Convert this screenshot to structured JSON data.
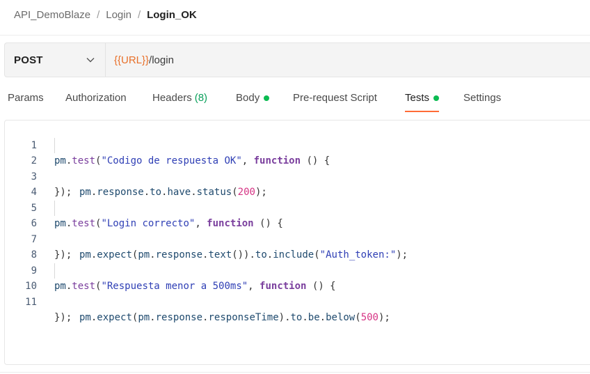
{
  "breadcrumb": {
    "collection": "API_DemoBlaze",
    "folder": "Login",
    "request": "Login_OK",
    "separator": "/"
  },
  "request": {
    "method": "POST",
    "url_variable": "{{URL}}",
    "url_path": "/login"
  },
  "tabs": {
    "params": "Params",
    "authorization": "Authorization",
    "headers": "Headers",
    "headers_count": "(8)",
    "body": "Body",
    "prerequest": "Pre-request Script",
    "tests": "Tests",
    "settings": "Settings"
  },
  "editor": {
    "line_numbers": [
      "1",
      "2",
      "3",
      "4",
      "5",
      "6",
      "7",
      "8",
      "9",
      "10",
      "11"
    ],
    "l1": {
      "obj": "pm",
      "p1": ".",
      "fn": "test",
      "p2": "(",
      "str": "\"Codigo de respuesta OK\"",
      "p3": ", ",
      "kw": "function",
      "p4": " () {"
    },
    "l2": {
      "a": "pm",
      "b": ".",
      "c": "response",
      "d": ".",
      "e": "to",
      "f": ".",
      "g": "have",
      "h": ".",
      "i": "status",
      "j": "(",
      "num": "200",
      "k": ");"
    },
    "l3": "});",
    "l5": {
      "obj": "pm",
      "p1": ".",
      "fn": "test",
      "p2": "(",
      "str": "\"Login correcto\"",
      "p3": ", ",
      "kw": "function",
      "p4": " () {"
    },
    "l6": {
      "a": "pm",
      "b": ".",
      "c": "expect",
      "d": "(",
      "e": "pm",
      "f": ".",
      "g": "response",
      "h": ".",
      "i": "text",
      "j": "()).",
      "k": "to",
      "l": ".",
      "m": "include",
      "n": "(",
      "str": "\"Auth_token:\"",
      "o": ");"
    },
    "l7": "});",
    "l9": {
      "obj": "pm",
      "p1": ".",
      "fn": "test",
      "p2": "(",
      "str": "\"Respuesta menor a 500ms\"",
      "p3": ", ",
      "kw": "function",
      "p4": " () {"
    },
    "l10": {
      "a": "pm",
      "b": ".",
      "c": "expect",
      "d": "(",
      "e": "pm",
      "f": ".",
      "g": "response",
      "h": ".",
      "i": "responseTime",
      "j": ").",
      "k": "to",
      "l": ".",
      "m": "be",
      "n": ".",
      "o": "below",
      "p": "(",
      "num": "500",
      "q": ");"
    },
    "l11": "});"
  },
  "colors": {
    "accent": "#ff6c37",
    "status_dot": "#0cbb52",
    "url_variable": "#e8702a"
  },
  "icons": {
    "method_dropdown": "chevron-down-icon",
    "body_indicator": "green-dot-icon",
    "tests_indicator": "green-dot-icon"
  }
}
